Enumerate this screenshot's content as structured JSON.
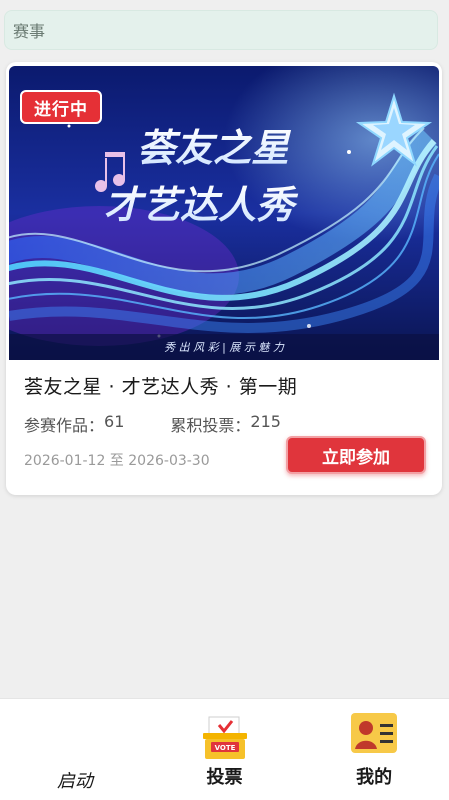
{
  "header": {
    "title": "赛事"
  },
  "card": {
    "status": "进行中",
    "banner": {
      "title_line1": "荟友之星",
      "title_line2": "才艺达人秀",
      "tagline": "秀 出 风 彩 | 展 示 魅 力"
    },
    "title": "荟友之星 · 才艺达人秀 · 第一期",
    "works_label": "参赛作品：",
    "works_count": "61",
    "votes_label": "累积投票：",
    "votes_count": "215",
    "date_range": "2026-01-12 至 2026-03-30",
    "join_label": "立即参加"
  },
  "tabbar": {
    "tabs": [
      {
        "label": "启动",
        "icon": "launch-icon"
      },
      {
        "label": "投票",
        "icon": "vote-box-icon",
        "icon_text": "VOTE"
      },
      {
        "label": "我的",
        "icon": "profile-card-icon"
      }
    ]
  },
  "colors": {
    "accent": "#e0353c",
    "header_bg": "#e4f1ec",
    "page_bg": "#efefef"
  }
}
